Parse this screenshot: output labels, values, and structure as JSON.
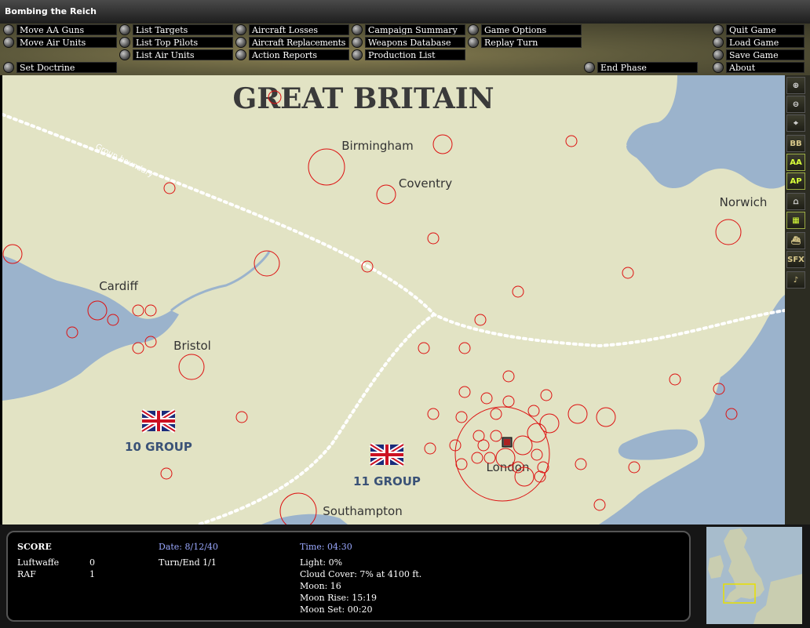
{
  "window": {
    "title": "Bombing the Reich"
  },
  "menu": {
    "move_aa_guns": "Move AA Guns",
    "move_air_units": "Move Air Units",
    "set_doctrine": "Set Doctrine",
    "list_targets": "List Targets",
    "list_top_pilots": "List Top Pilots",
    "list_air_units": "List Air Units",
    "aircraft_losses": "Aircraft Losses",
    "aircraft_replacements": "Aircraft Replacements",
    "action_reports": "Action Reports",
    "campaign_summary": "Campaign Summary",
    "weapons_database": "Weapons Database",
    "production_list": "Production List",
    "game_options": "Game Options",
    "replay_turn": "Replay Turn",
    "end_phase": "End Phase",
    "quit_game": "Quit Game",
    "load_game": "Load Game",
    "save_game": "Save Game",
    "about": "About"
  },
  "map": {
    "title": "GREAT BRITAIN",
    "boundary_label": "Group boundary",
    "cities": {
      "birmingham": "Birmingham",
      "coventry": "Coventry",
      "norwich": "Norwich",
      "cardiff": "Cardiff",
      "bristol": "Bristol",
      "london": "London",
      "southampton": "Southampton"
    },
    "groups": {
      "g10": "10 GROUP",
      "g11": "11 GROUP"
    },
    "colors": {
      "land": "#e2e3c4",
      "sea": "#9bb3cc",
      "target_ring": "#dd1111",
      "group_text": "#3a5277"
    }
  },
  "toolbar": {
    "bb": "BB",
    "aa": "AA",
    "ap": "AP",
    "sfx": "SFX",
    "icons": [
      "zoom-in-icon",
      "zoom-out-icon",
      "crosshair-icon",
      "bb-toggle",
      "aa-toggle",
      "ap-toggle",
      "bridge-icon",
      "factory-icon",
      "ship-icon",
      "sfx-toggle",
      "music-note-icon"
    ]
  },
  "status": {
    "score_label": "SCORE",
    "luftwaffe_label": "Luftwaffe",
    "luftwaffe_score": "0",
    "raf_label": "RAF",
    "raf_score": "1",
    "date": "Date: 8/12/40",
    "turn": "Turn/End 1/1",
    "time": "Time: 04:30",
    "light": "Light: 0%",
    "cloud": "Cloud Cover: 7% at 4100 ft.",
    "moon": "Moon: 16",
    "moon_rise": "Moon Rise: 15:19",
    "moon_set": "Moon Set: 00:20"
  }
}
